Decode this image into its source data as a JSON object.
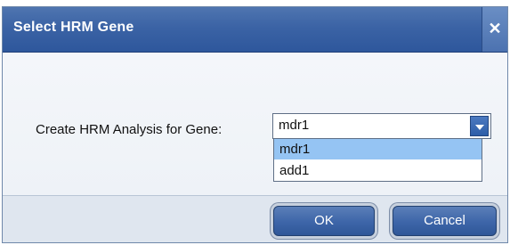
{
  "dialog": {
    "title": "Select HRM Gene",
    "close_symbol": "✕"
  },
  "form": {
    "gene_label": "Create HRM Analysis for Gene:",
    "selected_value": "mdr1",
    "options": [
      "mdr1",
      "add1"
    ],
    "highlighted_option": "mdr1"
  },
  "buttons": {
    "ok": "OK",
    "cancel": "Cancel"
  },
  "icons": {
    "close": "close-icon",
    "dropdown": "chevron-down-icon"
  },
  "colors": {
    "titlebar": "#3b63a5",
    "highlight": "#95c4f3"
  }
}
